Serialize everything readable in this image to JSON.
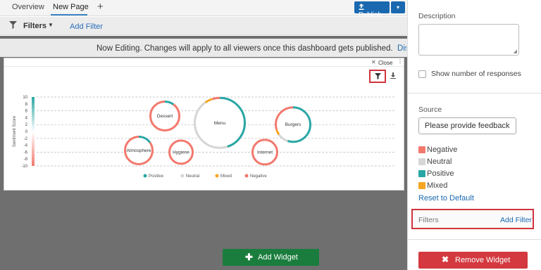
{
  "tabs": {
    "overview": "Overview",
    "new_page": "New Page",
    "add": "+"
  },
  "toolbar": {
    "publish": "Publish",
    "publish_icon": "upload-icon",
    "caret": "▾"
  },
  "filterbar": {
    "filters": "Filters",
    "add_filter": "Add Filter"
  },
  "editing_note": {
    "text": "Now Editing. Changes will apply to all viewers once this dashboard gets published.",
    "link": "Discard"
  },
  "widget": {
    "close": "Close"
  },
  "add_widget": "Add Widget",
  "panel": {
    "description_label": "Description",
    "description_value": "",
    "show_responses": "Show number of responses",
    "source_label": "Source",
    "source_value": "Please provide feedback",
    "legend": [
      {
        "label": "Negative",
        "color": "#f3796d"
      },
      {
        "label": "Neutral",
        "color": "#d6d6d6"
      },
      {
        "label": "Positive",
        "color": "#2aa7a5"
      },
      {
        "label": "Mixed",
        "color": "#f5a623"
      }
    ],
    "reset": "Reset to Default",
    "filters_label": "Filters",
    "add_filter": "Add Filter",
    "remove_widget": "Remove Widget"
  },
  "chart_data": {
    "type": "bubble",
    "ylabel": "Sentiment Score",
    "y_ticks": [
      "10",
      "8",
      "6",
      "4",
      "2",
      "0",
      "-2",
      "-4",
      "-6",
      "-8",
      "-10"
    ],
    "ylim": [
      -10,
      10
    ],
    "legend": [
      "Positive",
      "Neutral",
      "Mixed",
      "Negative"
    ],
    "colors": {
      "Positive": "#2aa7a5",
      "Neutral": "#d6d6d6",
      "Mixed": "#f5a623",
      "Negative": "#f3796d"
    },
    "bubbles": [
      {
        "label": "Dessert",
        "sentiment": 4.5,
        "size": 22,
        "mix": {
          "Positive": 0.1,
          "Neutral": 0,
          "Mixed": 0,
          "Negative": 0.9
        }
      },
      {
        "label": "Menu",
        "sentiment": 2.5,
        "size": 37,
        "mix": {
          "Positive": 0.45,
          "Neutral": 0.45,
          "Mixed": 0.05,
          "Negative": 0.05
        }
      },
      {
        "label": "Burgers",
        "sentiment": 2.0,
        "size": 26,
        "mix": {
          "Positive": 0.55,
          "Neutral": 0.1,
          "Mixed": 0.05,
          "Negative": 0.3
        }
      },
      {
        "label": "Atmosphere",
        "sentiment": -5.5,
        "size": 21,
        "mix": {
          "Positive": 0.15,
          "Neutral": 0,
          "Mixed": 0,
          "Negative": 0.85
        }
      },
      {
        "label": "Hygiene",
        "sentiment": -6.0,
        "size": 18,
        "mix": {
          "Positive": 0,
          "Neutral": 0,
          "Mixed": 0,
          "Negative": 1.0
        }
      },
      {
        "label": "Internet",
        "sentiment": -6.0,
        "size": 19,
        "mix": {
          "Positive": 0,
          "Neutral": 0,
          "Mixed": 0,
          "Negative": 1.0
        }
      }
    ]
  }
}
